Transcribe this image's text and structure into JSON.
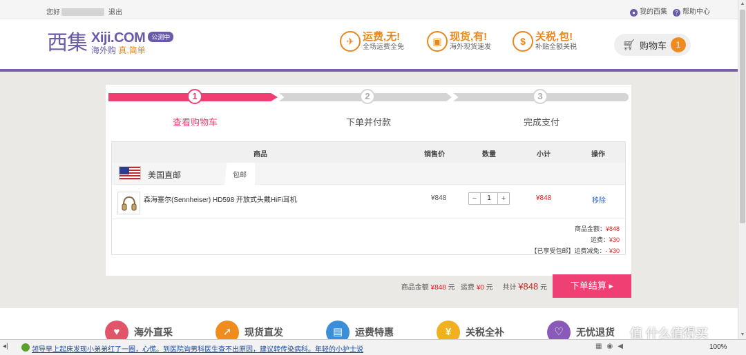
{
  "topbar": {
    "greeting": "您好",
    "logout": "退出",
    "my_account": "我的西集",
    "help": "帮助中心"
  },
  "header": {
    "logo_cn": "西集",
    "logo_en": "Xiji.COM",
    "beta_badge": "公测中",
    "slogan_pre": "海外购 ",
    "slogan_hl": "真,简单",
    "features": [
      {
        "title": "运费,无!",
        "sub": "全场运费全免",
        "icon": "plane-icon"
      },
      {
        "title": "现货,有!",
        "sub": "海外现货速发",
        "icon": "box-icon"
      },
      {
        "title": "关税,包!",
        "sub": "补贴全额关税",
        "icon": "coin-icon"
      }
    ],
    "cart_label": "购物车",
    "cart_count": "1"
  },
  "steps": [
    {
      "num": "1",
      "label": "查看购物车",
      "active": true
    },
    {
      "num": "2",
      "label": "下单并付款",
      "active": false
    },
    {
      "num": "3",
      "label": "完成支付",
      "active": false
    }
  ],
  "table": {
    "headers": {
      "product": "商品",
      "price": "销售价",
      "qty": "数量",
      "subtotal": "小计",
      "action": "操作"
    },
    "group": {
      "name": "美国直邮",
      "tag": "包邮"
    },
    "item": {
      "name": "森海塞尔(Sennheiser) HD598 开放式头戴HiFi耳机",
      "price": "¥848",
      "qty": "1",
      "minus": "−",
      "plus": "+",
      "subtotal": "¥848",
      "remove": "移除"
    },
    "summary": {
      "goods_label": "商品金额：",
      "goods_value": "¥848",
      "freight_label": "运费：",
      "freight_value": "¥30",
      "discount_label": "【已享受包邮】运费减免：",
      "discount_value": "- ¥30"
    }
  },
  "footer_bar": {
    "goods_label": "商品金额",
    "goods_value": "¥848",
    "goods_unit": "元",
    "freight_label": "运费",
    "freight_value": "¥0",
    "freight_unit": "元",
    "total_label": "共计",
    "total_value": "¥848",
    "total_unit": "元",
    "checkout": "下单结算 ▸"
  },
  "bottom_features": [
    {
      "label": "海外直采",
      "color": "#e0556a"
    },
    {
      "label": "现货直发",
      "color": "#f08c1e"
    },
    {
      "label": "运费特惠",
      "color": "#3a8fd8"
    },
    {
      "label": "关税全补",
      "color": "#f0b020"
    },
    {
      "label": "无忧退货",
      "color": "#8a5ab8"
    }
  ],
  "statusbar": {
    "news": "领导早上起床发现小弟弟红了一圈，心慌。到医院询男科医生查不出原因，建议转传染病科。年轻的小护士说",
    "zoom": "100%"
  },
  "watermark": "值 什么值得买"
}
